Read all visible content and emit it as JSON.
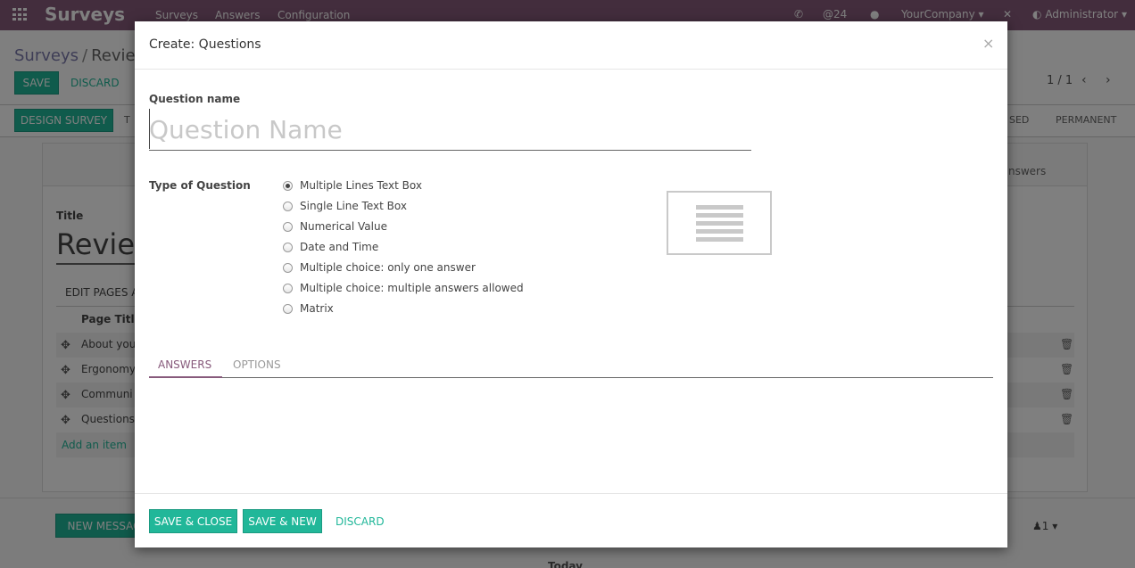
{
  "navbar": {
    "brand": "Surveys",
    "menu": [
      "Surveys",
      "Answers",
      "Configuration"
    ],
    "messages_count": "@24",
    "company": "YourCompany",
    "user": "Administrator"
  },
  "control_panel": {
    "breadcrumb_root": "Surveys",
    "breadcrumb_sep": "/",
    "breadcrumb_current": "Revie",
    "save_label": "SAVE",
    "discard_label": "DISCARD",
    "pager": "1 / 1"
  },
  "statusbar": {
    "design_label": "DESIGN SURVEY",
    "stage_partial_left": "T",
    "stage_partial_right": "SED",
    "stage_permanent": "PERMANENT"
  },
  "sheet": {
    "button_box_text": "nswers",
    "title_label": "Title",
    "title_value": "Revie",
    "notebook_tab": "EDIT PAGES A",
    "column_header": "Page Title",
    "rows": [
      "About you",
      "Ergonomy",
      "Communi",
      "Questions"
    ],
    "add_item": "Add an item"
  },
  "chatter": {
    "new_message": "NEW MESSAG",
    "followers": "1",
    "today": "Today"
  },
  "modal": {
    "title": "Create: Questions",
    "close": "×",
    "question_name_label": "Question name",
    "question_name_placeholder": "Question Name",
    "type_label": "Type of Question",
    "types": [
      "Multiple Lines Text Box",
      "Single Line Text Box",
      "Numerical Value",
      "Date and Time",
      "Multiple choice: only one answer",
      "Multiple choice: multiple answers allowed",
      "Matrix"
    ],
    "selected_type": "Multiple Lines Text Box",
    "tabs": [
      "ANSWERS",
      "OPTIONS"
    ],
    "active_tab": "ANSWERS",
    "footer": {
      "save_close": "SAVE & CLOSE",
      "save_new": "SAVE & NEW",
      "discard": "DISCARD"
    }
  },
  "colors": {
    "brand": "#875a7b",
    "primary": "#21b799"
  }
}
